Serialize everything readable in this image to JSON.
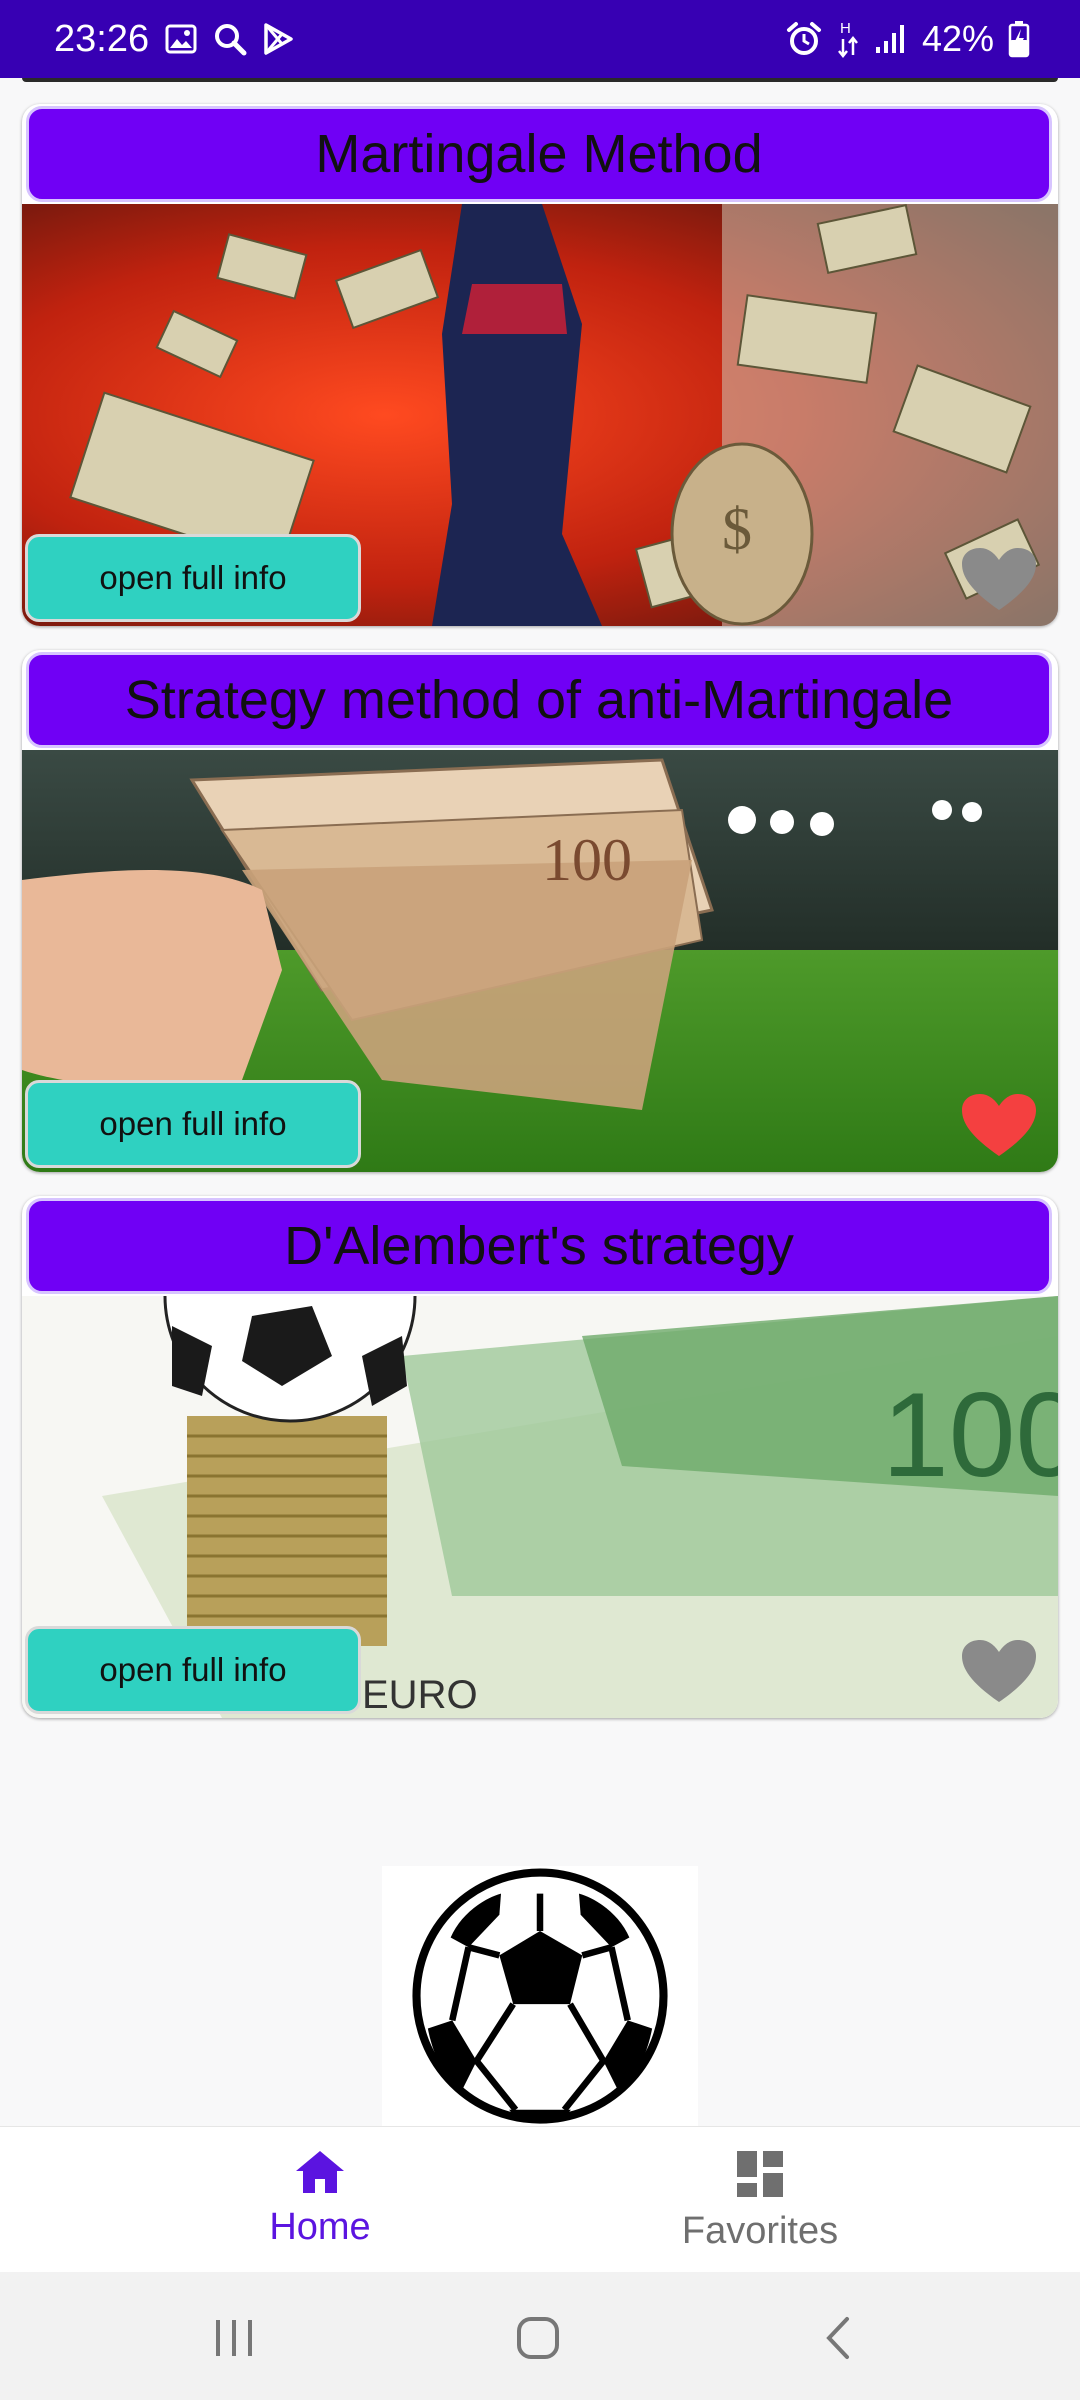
{
  "status_bar": {
    "time": "23:26",
    "battery": "42%",
    "network": "H",
    "icons": [
      "gallery-icon",
      "search-icon",
      "play-store-icon",
      "alarm-icon",
      "data-arrows-icon",
      "signal-icon",
      "battery-charging-icon"
    ]
  },
  "cards": [
    {
      "title": "Martingale Method",
      "button": "open full info",
      "favorite": false
    },
    {
      "title": "Strategy method of anti-Martingale",
      "button": "open full info",
      "favorite": true
    },
    {
      "title": "D'Alembert's strategy",
      "button": "open full info",
      "favorite": false
    }
  ],
  "bottom_nav": {
    "home": "Home",
    "favorites": "Favorites",
    "active": "home"
  },
  "colors": {
    "status_bar": "#3700b3",
    "title_bg": "#7000f5",
    "button_bg": "#2fd1c1",
    "heart_active": "#f44040",
    "heart_inactive": "#8a8a8a",
    "nav_active": "#5b14e0"
  }
}
